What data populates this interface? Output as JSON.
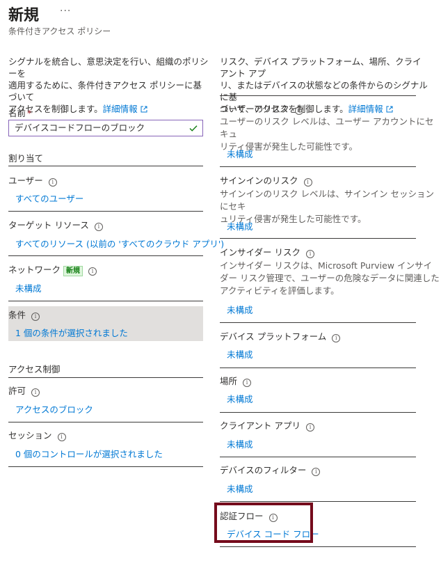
{
  "header": {
    "title": "新規",
    "more": "···",
    "subtitle": "条件付きアクセス ポリシー"
  },
  "left": {
    "intro_line1": "シグナルを統合し、意思決定を行い、組織のポリシーを",
    "intro_line2": "適用するために、条件付きアクセス ポリシーに基づいて",
    "intro_line3": "アクセスを制御します。",
    "intro_link": "詳細情報",
    "name_label": "名前",
    "name_required": "*",
    "name_value": "デバイスコードフローのブロック",
    "assignments_heading": "割り当て",
    "users_label": "ユーザー",
    "users_value": "すべてのユーザー",
    "target_label": "ターゲット リソース",
    "target_value": "すべてのリソース (以前の 'すべてのクラウド アプリ')",
    "network_label": "ネットワーク",
    "network_badge": "新規",
    "network_value": "未構成",
    "conditions_label": "条件",
    "conditions_value": "1 個の条件が選択されました",
    "access_heading": "アクセス制御",
    "grant_label": "許可",
    "grant_value": "アクセスのブロック",
    "session_label": "セッション",
    "session_value": "0 個のコントロールが選択されました"
  },
  "right": {
    "intro_line1": "リスク、デバイス プラットフォーム、場所、クライアント アプ",
    "intro_line2": "リ、またはデバイスの状態などの条件からのシグナルに基",
    "intro_line3": "づいて、アクセスを制御します。",
    "intro_link": "詳細情報",
    "user_risk_label": "ユーザーのリスク",
    "user_risk_desc1": "ユーザーのリスク レベルは、ユーザー アカウントにセキュ",
    "user_risk_desc2": "リティ侵害が発生した可能性です。",
    "user_risk_value": "未構成",
    "signin_risk_label": "サインインのリスク",
    "signin_risk_desc1": "サインインのリスク レベルは、サインイン セッションにセキ",
    "signin_risk_desc2": "ュリティ侵害が発生した可能性です。",
    "signin_risk_value": "未構成",
    "insider_label": "インサイダー リスク",
    "insider_desc1": "インサイダー リスクは、Microsoft Purview インサイ",
    "insider_desc2": "ダー リスク管理で、ユーザーの危険なデータに関連した",
    "insider_desc3": "アクティビティを評価します。",
    "insider_value": "未構成",
    "platform_label": "デバイス プラットフォーム",
    "platform_value": "未構成",
    "location_label": "場所",
    "location_value": "未構成",
    "client_label": "クライアント アプリ",
    "client_value": "未構成",
    "filter_label": "デバイスのフィルター",
    "filter_value": "未構成",
    "auth_label": "認証フロー",
    "auth_value": "デバイス コード フロー"
  },
  "icons": {
    "info": "i",
    "external": "external-link-icon",
    "check": "check-icon"
  },
  "colors": {
    "link": "#0078d4",
    "highlight_border": "#750b1c",
    "input_border": "#8764b8",
    "conditions_bg": "#e1dfdd",
    "badge_bg": "#dff6dd",
    "badge_text": "#107c10"
  }
}
